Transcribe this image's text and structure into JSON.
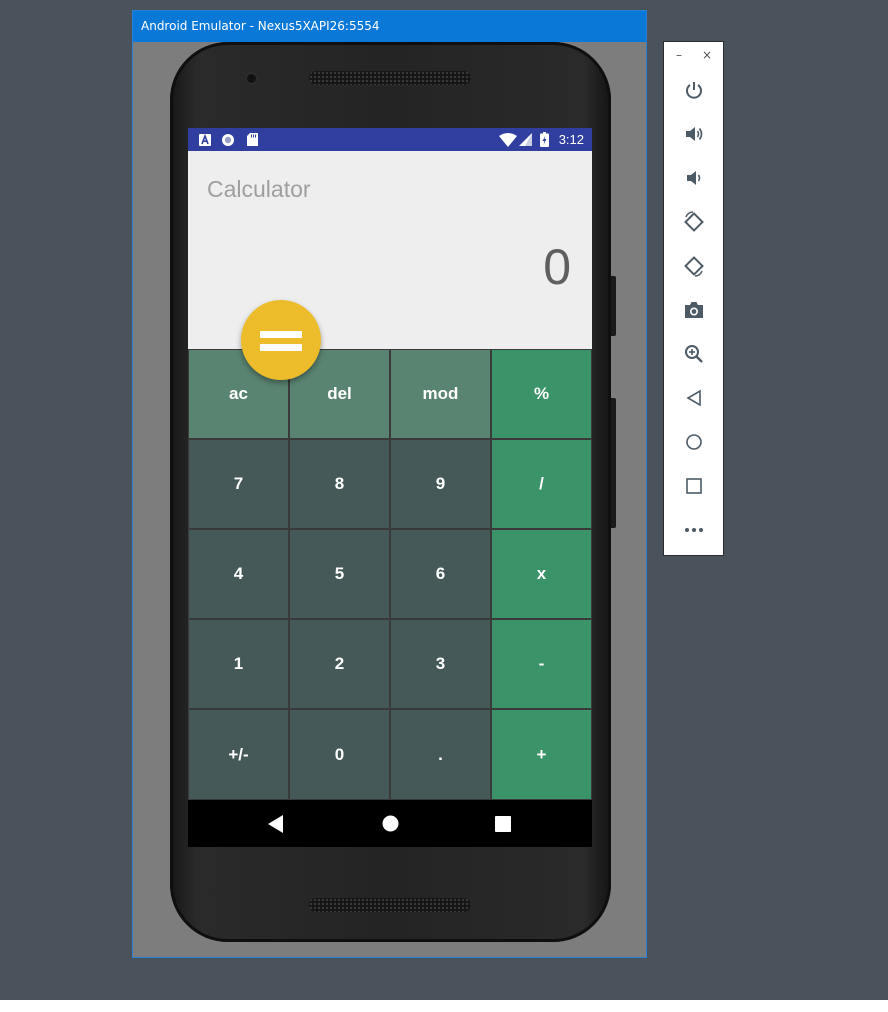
{
  "window": {
    "title": "Android Emulator - Nexus5XAPI26:5554"
  },
  "status_bar": {
    "time": "3:12",
    "left_icons": [
      "a-badge-icon",
      "circle-notification-icon",
      "sd-card-icon"
    ],
    "right_icons": [
      "wifi-icon",
      "cell-signal-icon",
      "battery-charging-icon"
    ]
  },
  "app": {
    "title": "Calculator",
    "display": "0",
    "equals_button": "equals-icon",
    "keys": [
      [
        "ac",
        "del",
        "mod",
        "%"
      ],
      [
        "7",
        "8",
        "9",
        "/"
      ],
      [
        "4",
        "5",
        "6",
        "x"
      ],
      [
        "1",
        "2",
        "3",
        "-"
      ],
      [
        "+/-",
        "0",
        ".",
        "+"
      ]
    ]
  },
  "nav_bar": {
    "buttons": [
      "back-icon",
      "home-icon",
      "recents-icon"
    ]
  },
  "emulator_toolbar": {
    "window_controls": {
      "minimize": "–",
      "close": "×"
    },
    "buttons": [
      "power-icon",
      "volume-up-icon",
      "volume-down-icon",
      "rotate-left-icon",
      "rotate-right-icon",
      "camera-icon",
      "zoom-icon",
      "back-icon",
      "home-icon",
      "overview-icon",
      "more-icon"
    ]
  },
  "colors": {
    "desktop": "#4a535b",
    "titlebar": "#0a78d7",
    "status_bar": "#303f9f",
    "key_function": "#5a8472",
    "key_number": "#455a58",
    "key_operator": "#3b936a",
    "fab": "#ecbc2a"
  }
}
